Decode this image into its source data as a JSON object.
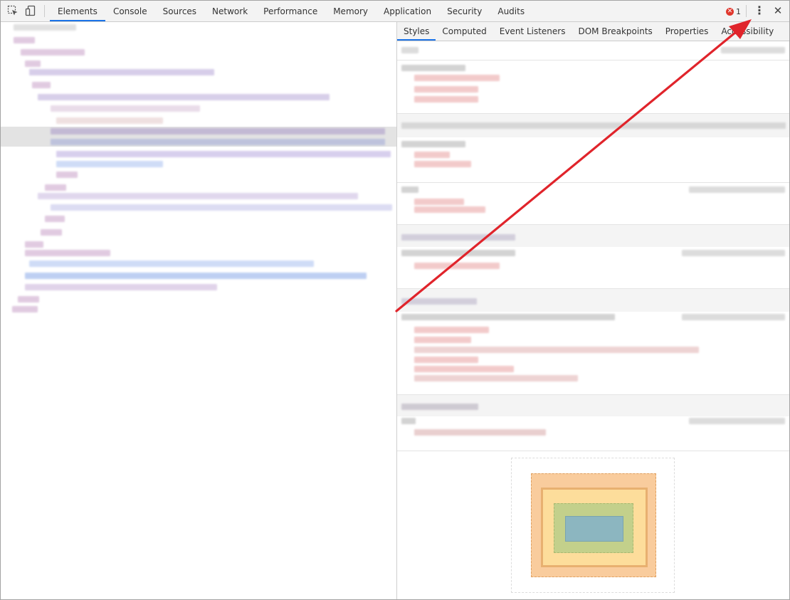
{
  "toolbar": {
    "tabs": [
      {
        "label": "Elements"
      },
      {
        "label": "Console"
      },
      {
        "label": "Sources"
      },
      {
        "label": "Network"
      },
      {
        "label": "Performance"
      },
      {
        "label": "Memory"
      },
      {
        "label": "Application"
      },
      {
        "label": "Security"
      },
      {
        "label": "Audits"
      }
    ],
    "error_count": "1",
    "more_icon": "⋮",
    "close_icon": "✕",
    "error_icon_glyph": "✕"
  },
  "sidebar": {
    "tabs": [
      {
        "label": "Styles"
      },
      {
        "label": "Computed"
      },
      {
        "label": "Event Listeners"
      },
      {
        "label": "DOM Breakpoints"
      },
      {
        "label": "Properties"
      },
      {
        "label": "Accessibility"
      }
    ]
  },
  "colors": {
    "accent": "#1a73e8",
    "error": "#e0382e",
    "annotation_arrow": "#e0242b",
    "margin_box": "#f9cc9d",
    "border_box": "#fddd9b",
    "padding_box": "#c3d08b",
    "content_box": "#8cb6c0"
  }
}
